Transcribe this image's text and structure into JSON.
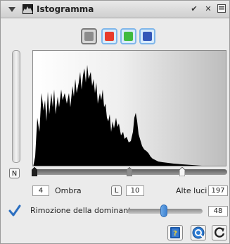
{
  "titlebar": {
    "title": "Istogramma",
    "buttons": [
      {
        "name": "check-icon",
        "glyph": "✔"
      },
      {
        "name": "close-icon",
        "glyph": "✕"
      },
      {
        "name": "menu-icon",
        "glyph": "▤"
      }
    ]
  },
  "channels": {
    "colors": {
      "gray": "#8c8c8c",
      "red": "#e83a2a",
      "green": "#3fba3f",
      "blue": "#3457b8"
    }
  },
  "buttons": {
    "n_label": "N",
    "l_label": "L"
  },
  "levels": {
    "shadow_value": "4",
    "shadow_label": "Ombra",
    "midtone_value": "10",
    "highlight_label": "Alte luci",
    "highlight_value": "197"
  },
  "dominant": {
    "label": "Rimozione della dominante",
    "value": "48",
    "checked": true,
    "slider_fraction": 0.48
  }
}
